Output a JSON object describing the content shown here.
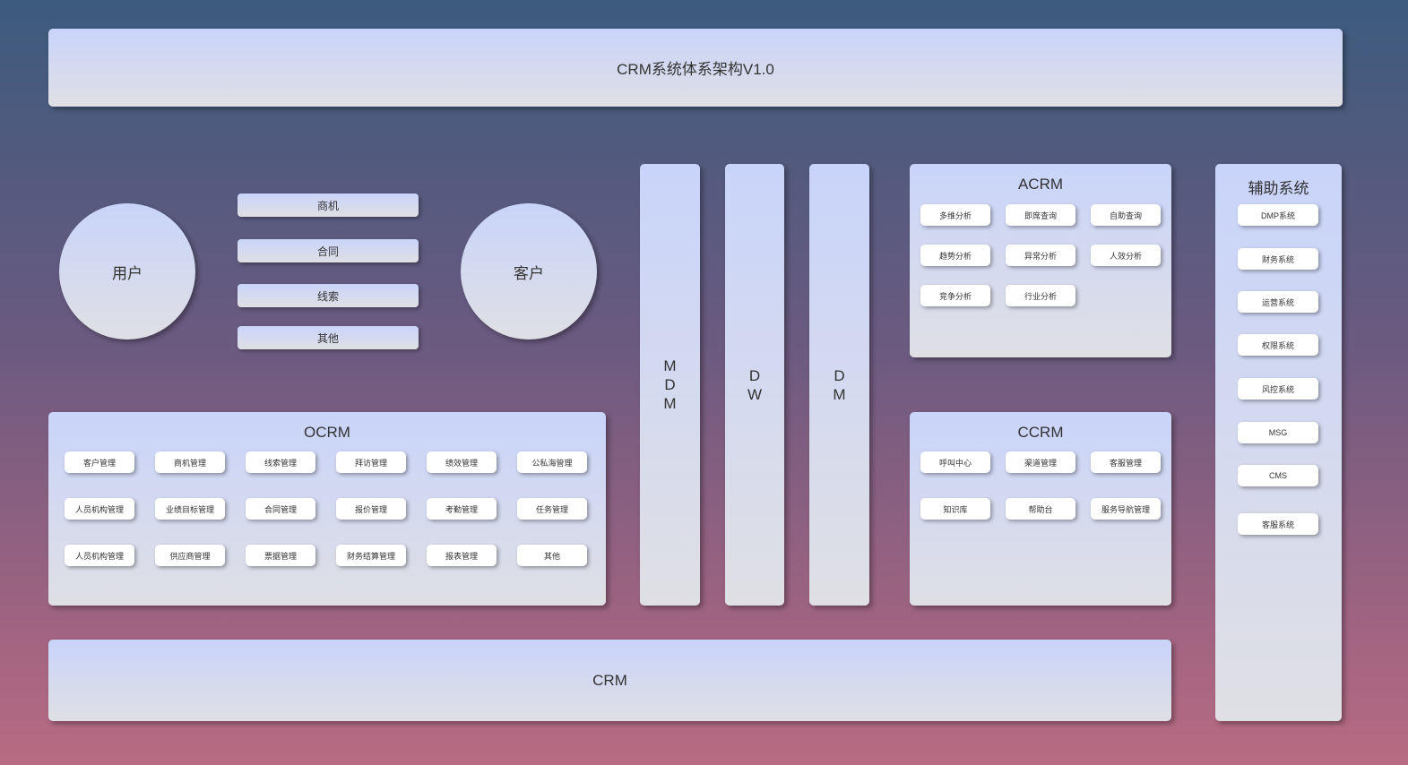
{
  "title": "CRM系统体系架构V1.0",
  "user_label": "用户",
  "customer_label": "客户",
  "flows": [
    "商机",
    "合同",
    "线索",
    "其他"
  ],
  "ocrm": {
    "title": "OCRM",
    "items": [
      "客户管理",
      "商机管理",
      "线索管理",
      "拜访管理",
      "绩效管理",
      "公私海管理",
      "人员机构管理",
      "业绩目标管理",
      "合同管理",
      "报价管理",
      "考勤管理",
      "任务管理",
      "人员机构管理",
      "供应商管理",
      "票据管理",
      "财务结算管理",
      "报表管理",
      "其他"
    ]
  },
  "columns": [
    "MDM",
    "DW",
    "DM"
  ],
  "acrm": {
    "title": "ACRM",
    "items": [
      "多维分析",
      "即席查询",
      "自助查询",
      "趋势分析",
      "异常分析",
      "人效分析",
      "竞争分析",
      "行业分析"
    ]
  },
  "ccrm": {
    "title": "CCRM",
    "items": [
      "呼叫中心",
      "渠道管理",
      "客服管理",
      "知识库",
      "帮助台",
      "服务导航管理"
    ]
  },
  "aux": {
    "title": "辅助系统",
    "items": [
      "DMP系统",
      "财务系统",
      "运营系统",
      "权限系统",
      "风控系统",
      "MSG",
      "CMS",
      "客服系统"
    ]
  },
  "crm_label": "CRM"
}
